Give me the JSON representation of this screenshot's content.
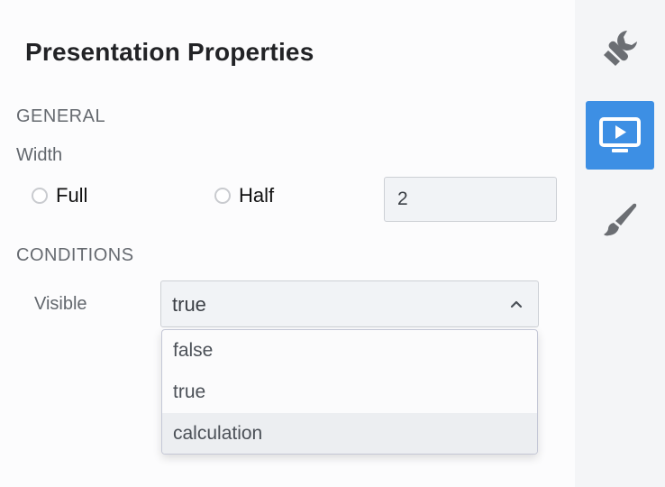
{
  "panel": {
    "title": "Presentation Properties",
    "general": {
      "heading": "GENERAL",
      "width_label": "Width",
      "options": [
        {
          "label": "Full",
          "checked": false
        },
        {
          "label": "Half",
          "checked": false
        }
      ],
      "width_value": "2"
    },
    "conditions": {
      "heading": "CONDITIONS",
      "visible_label": "Visible",
      "selected": "true",
      "dropdown_open": true,
      "options": [
        "false",
        "true",
        "calculation"
      ],
      "highlighted_option": "calculation"
    }
  },
  "rail": {
    "items": [
      {
        "icon": "wrench-icon",
        "active": false
      },
      {
        "icon": "presentation-icon",
        "active": true
      },
      {
        "icon": "brush-icon",
        "active": false
      }
    ]
  },
  "colors": {
    "accent": "#3d8fe4",
    "icon_gray": "#6b6e73",
    "highlight_bg": "#eceef1"
  }
}
